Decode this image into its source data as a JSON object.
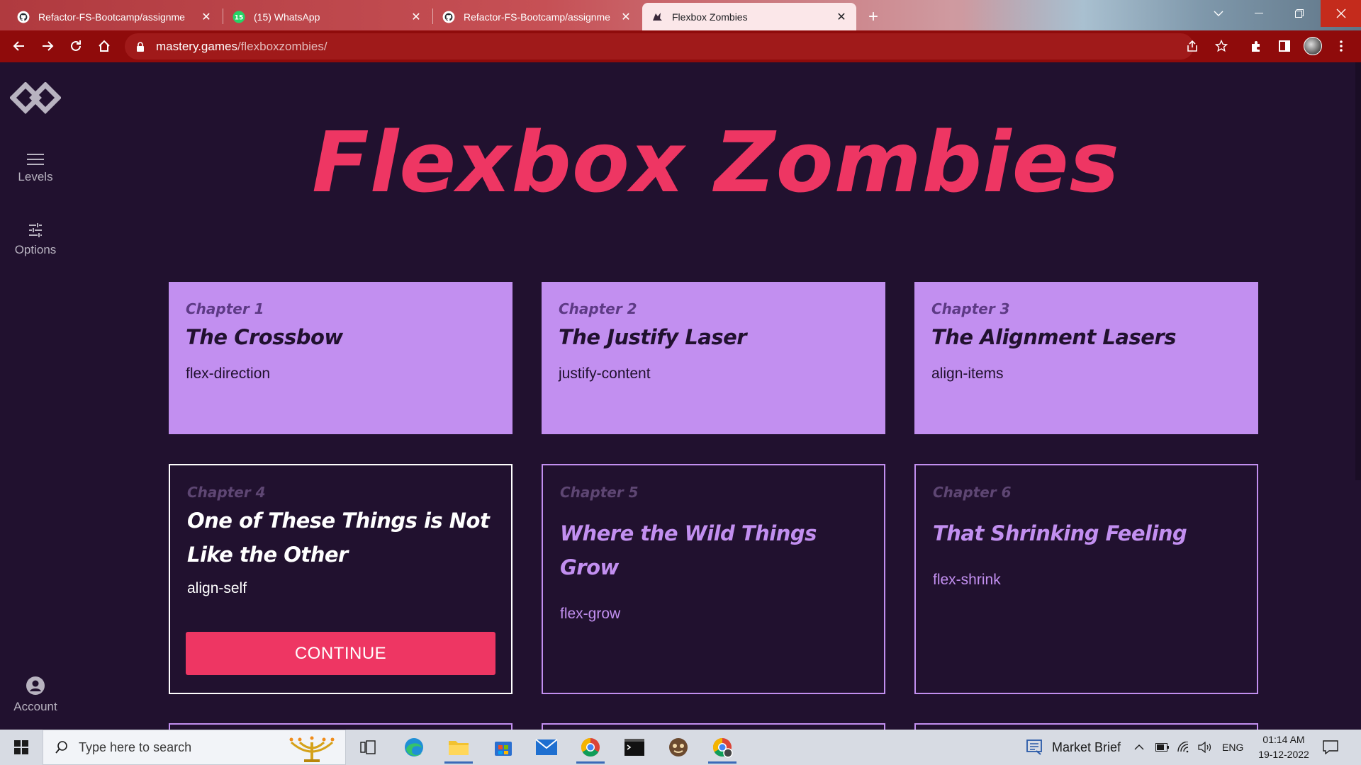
{
  "browser": {
    "tabs": [
      {
        "title": "Refactor-FS-Bootcamp/assignme",
        "icon": "github-icon",
        "active": false
      },
      {
        "title": "(15) WhatsApp",
        "icon": "whatsapp-icon",
        "badge": "15",
        "active": false
      },
      {
        "title": "Refactor-FS-Bootcamp/assignme",
        "icon": "github-icon",
        "active": false
      },
      {
        "title": "Flexbox Zombies",
        "icon": "zombie-icon",
        "active": true
      }
    ],
    "url_host": "mastery.games",
    "url_path": "/flexboxzombies/",
    "colors": {
      "toolbar": "#8f0b0b",
      "active_tab": "#fbe7e9"
    }
  },
  "sidebar": {
    "logo": "mastery-games-logo",
    "items": [
      {
        "label": "Levels",
        "icon": "menu-icon"
      },
      {
        "label": "Options",
        "icon": "sliders-icon"
      }
    ],
    "account": {
      "label": "Account",
      "icon": "account-icon"
    }
  },
  "main": {
    "title": "Flexbox Zombies",
    "colors": {
      "accent": "#ee3663",
      "completed": "#c28ff0",
      "background": "#21112f"
    },
    "chapters": [
      {
        "number": "Chapter 1",
        "name": "The Crossbow",
        "property": "flex-direction",
        "status": "completed"
      },
      {
        "number": "Chapter 2",
        "name": "The Justify Laser",
        "property": "justify-content",
        "status": "completed"
      },
      {
        "number": "Chapter 3",
        "name": "The Alignment Lasers",
        "property": "align-items",
        "status": "completed"
      },
      {
        "number": "Chapter 4",
        "name": "One of These Things is Not Like the Other",
        "property": "align-self",
        "status": "current",
        "button": "CONTINUE"
      },
      {
        "number": "Chapter 5",
        "name": "Where the Wild Things Grow",
        "property": "flex-grow",
        "status": "locked"
      },
      {
        "number": "Chapter 6",
        "name": "That Shrinking Feeling",
        "property": "flex-shrink",
        "status": "locked"
      }
    ]
  },
  "taskbar": {
    "search_placeholder": "Type here to search",
    "apps": [
      "task-view-icon",
      "edge-icon",
      "file-explorer-icon",
      "store-icon",
      "mail-icon",
      "chrome-icon",
      "terminal-icon",
      "app-icon",
      "chrome-profile-icon"
    ],
    "market_brief": "Market Brief",
    "language": "ENG",
    "time": "01:14 AM",
    "date": "19-12-2022"
  }
}
